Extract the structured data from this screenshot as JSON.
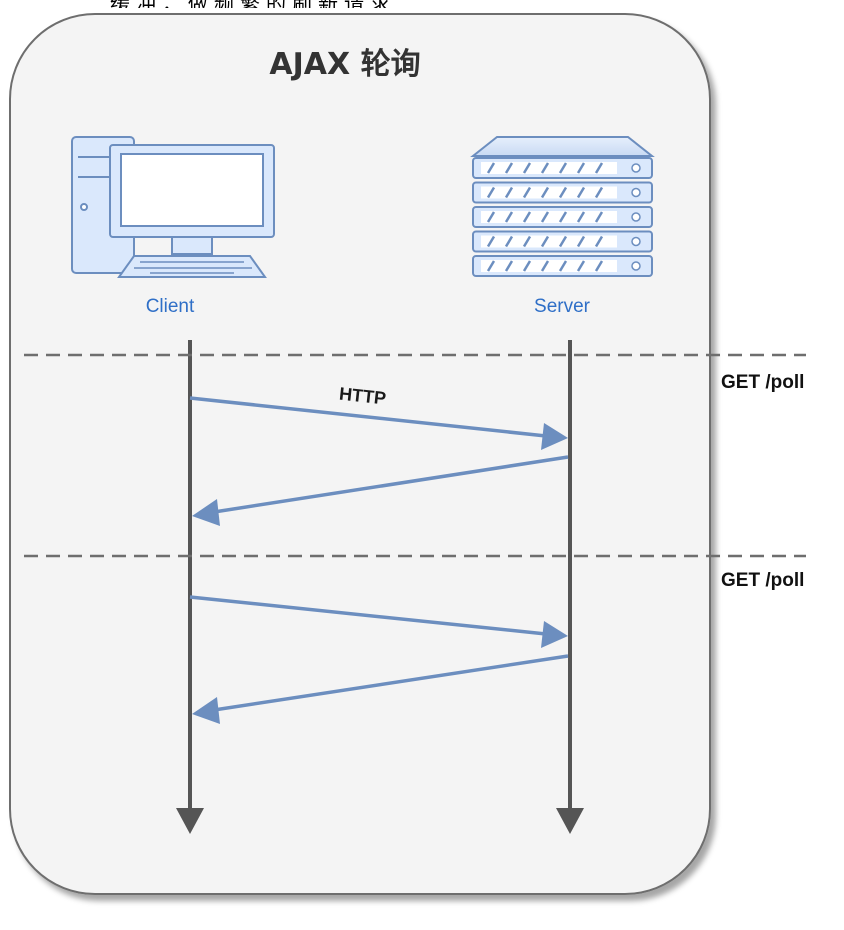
{
  "top_fragment": "缓冲，做频繁的刷新请求",
  "title": "AJAX 轮询",
  "lanes": {
    "client_label": "Client",
    "server_label": "Server"
  },
  "messages": {
    "first_request_label": "HTTP"
  },
  "separators": [
    {
      "label": "GET /poll"
    },
    {
      "label": "GET /poll"
    }
  ],
  "colors": {
    "panel_fill": "#f4f4f4",
    "panel_stroke": "#6e6e6e",
    "lifeline": "#555555",
    "message_arrow": "#6c8ebf",
    "lane_label": "#2f6fc7",
    "icon_fill": "#dae8fc",
    "icon_stroke": "#6c8ebf"
  },
  "icons": {
    "client": "desktop-computer-icon",
    "server": "server-rack-icon"
  }
}
